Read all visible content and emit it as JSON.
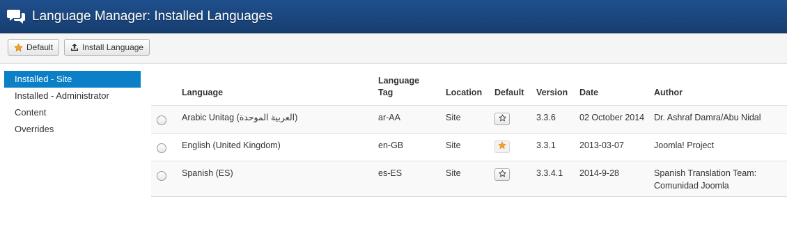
{
  "header": {
    "title": "Language Manager: Installed Languages",
    "icon": "comments-icon"
  },
  "toolbar": {
    "default_label": "Default",
    "default_icon": "star-icon",
    "install_label": "Install Language",
    "install_icon": "upload-icon"
  },
  "sidebar": {
    "items": [
      {
        "label": "Installed - Site",
        "active": true
      },
      {
        "label": "Installed - Administrator",
        "active": false
      },
      {
        "label": "Content",
        "active": false
      },
      {
        "label": "Overrides",
        "active": false
      }
    ]
  },
  "table": {
    "headers": {
      "language": "Language",
      "tag_line1": "Language",
      "tag_line2": "Tag",
      "location": "Location",
      "default": "Default",
      "version": "Version",
      "date": "Date",
      "author": "Author"
    },
    "rows": [
      {
        "language": "Arabic Unitag (العربية الموحدة)",
        "tag": "ar-AA",
        "location": "Site",
        "is_default": false,
        "version": "3.3.6",
        "date": "02 October 2014",
        "author": "Dr. Ashraf Damra/Abu Nidal"
      },
      {
        "language": "English (United Kingdom)",
        "tag": "en-GB",
        "location": "Site",
        "is_default": true,
        "version": "3.3.1",
        "date": "2013-03-07",
        "author": "Joomla! Project"
      },
      {
        "language": "Spanish (ES)",
        "tag": "es-ES",
        "location": "Site",
        "is_default": false,
        "version": "3.3.4.1",
        "date": "2014-9-28",
        "author": "Spanish Translation Team: Comunidad Joomla"
      }
    ]
  },
  "colors": {
    "header_bg": "#1b4781",
    "sidebar_active": "#0b80c7",
    "star_gold": "#f0a12a"
  }
}
